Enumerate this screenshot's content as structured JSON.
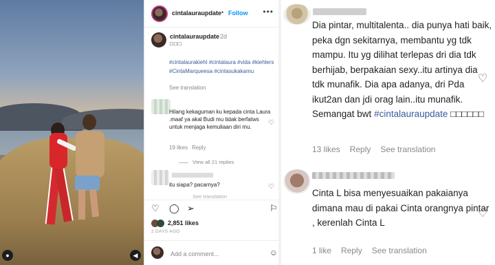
{
  "post": {
    "username": "cintalauraupdate",
    "follow_label": "Follow",
    "more_label": "•••",
    "dot": "•"
  },
  "caption": {
    "username": "cintalauraupdate",
    "time": "2d",
    "emoji": "□□□",
    "tags": "#cintalaurakiehl #cintalaura #vida #kiehlers #CintaMarqueesa #cintasukakamu",
    "see_translation": "See translation"
  },
  "comment1": {
    "text": "Hilang kekaguman ku kepada cinta Laura .maaf ya akal Budi mu tidak berfatws untuk menjaga kemuliaan diri mu.",
    "likes": "19 likes",
    "reply": "Reply",
    "view_replies": "View all 21 replies"
  },
  "comment2": {
    "text": "itu siapa? pacarnya?",
    "partial": "See translation"
  },
  "actions": {
    "like_icon": "heart-icon",
    "comment_icon": "comment-icon",
    "share_icon": "share-icon",
    "save_icon": "bookmark-icon",
    "likes": "2,851 likes",
    "ago": "2 DAYS AGO",
    "add_comment_placeholder": "Add a comment..."
  },
  "zoom_comment1": {
    "text": "Dia pintar, multitalenta.. dia punya hati baik, peka dgn sekitarnya, membantu yg tdk mampu. Itu yg dilihat terlepas dri dia tdk berhijab, berpakaian sexy..itu artinya dia tdk munafik. Dia apa adanya, dri Pda ikut2an dan jdi orag lain..itu munafik. Semangat bwt",
    "tag": "#cintalauraupdate",
    "emoji": "□□□□□□",
    "likes": "13 likes",
    "reply": "Reply",
    "see_translation": "See translation"
  },
  "zoom_comment2": {
    "text": "Cinta L bisa menyesuaikan pakaianya dimana mau di pakai Cinta orangnya pintar , kerenlah Cinta L",
    "likes": "1 like",
    "reply": "Reply",
    "see_translation": "See translation"
  },
  "colors": {
    "link_blue": "#0095f6",
    "hashtag": "#3a5b9a",
    "muted": "#888888"
  }
}
